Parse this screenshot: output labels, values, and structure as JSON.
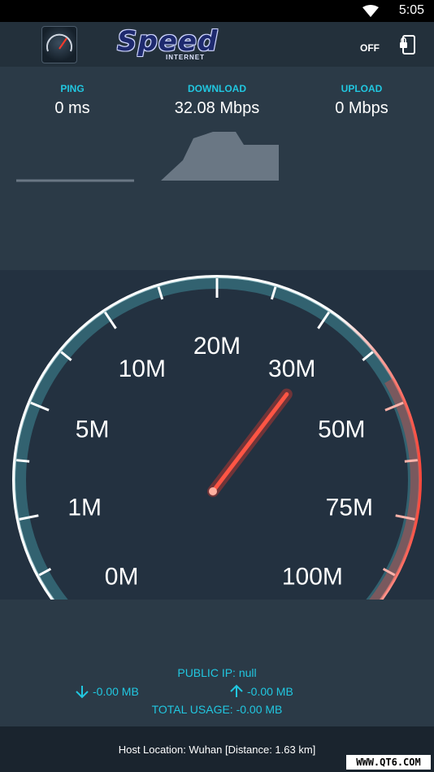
{
  "status_bar": {
    "time": "5:05",
    "wifi_icon": "wifi-icon"
  },
  "app_bar": {
    "logo_word": "Speed",
    "logo_sub": "INTERNET",
    "lock_toggle_label": "OFF",
    "lock_icon": "screen-lock-icon",
    "app_icon": "speedometer-app-icon"
  },
  "stats": {
    "ping": {
      "label": "PING",
      "value": "0 ms"
    },
    "download": {
      "label": "DOWNLOAD",
      "value": "32.08 Mbps"
    },
    "upload": {
      "label": "UPLOAD",
      "value": "0 Mbps"
    }
  },
  "gauge": {
    "scale_labels": [
      "0M",
      "1M",
      "5M",
      "10M",
      "20M",
      "30M",
      "50M",
      "75M",
      "100M"
    ],
    "needle_value_mbps": 32.08,
    "colors": {
      "arc_light": "#ffffff",
      "arc_teal": "#3f8a98",
      "arc_red": "#ff4a3d",
      "needle": "#ff3a2a"
    }
  },
  "usage": {
    "public_ip": "PUBLIC IP: null",
    "download_usage": "-0.00 MB",
    "upload_usage": "-0.00 MB",
    "total_usage": "TOTAL USAGE: -0.00 MB"
  },
  "footer": {
    "host_location": "Host Location: Wuhan [Distance: 1.63 km]",
    "watermark": "WWW.QT6.COM"
  },
  "colors": {
    "accent": "#21c7e0",
    "panel": "#2b3a47",
    "gauge_bg": "#233140"
  }
}
